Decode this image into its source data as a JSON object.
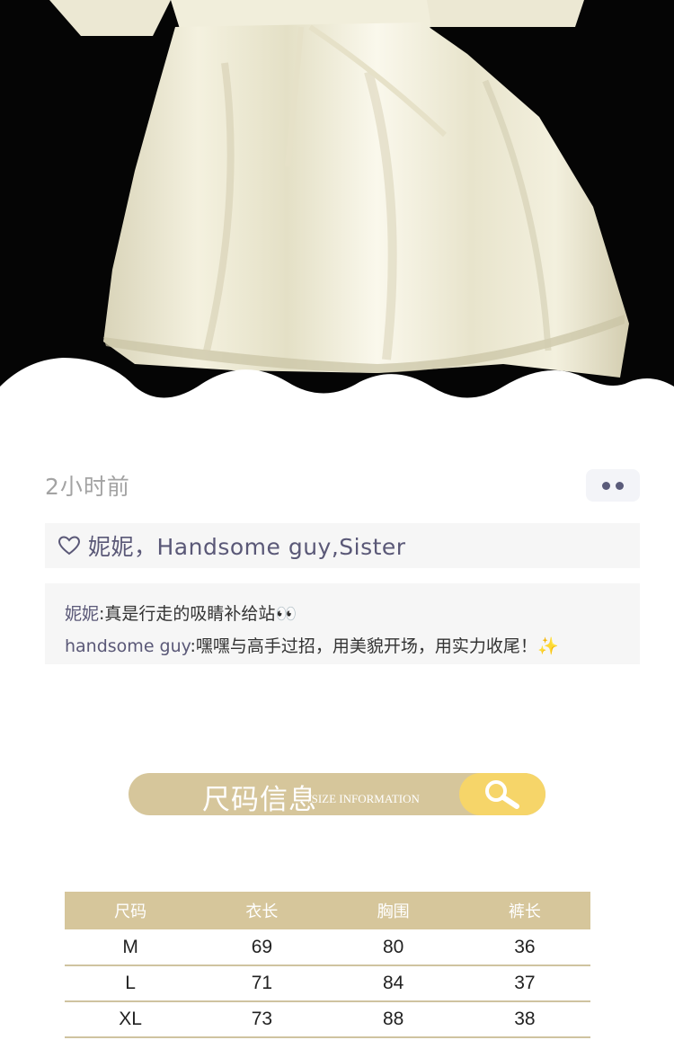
{
  "post": {
    "time": "2小时前",
    "likes": "妮妮，Handsome guy,Sister",
    "comments": [
      {
        "author": "妮妮",
        "text": "真是行走的吸睛补给站",
        "emoji": "👀"
      },
      {
        "author": "handsome guy",
        "text": "嘿嘿与高手过招，用美貌开场，用实力收尾！",
        "emoji": "✨"
      }
    ]
  },
  "section": {
    "title_cn": "尺码信息",
    "title_en": "/SIZE INFORMATION"
  },
  "size_table": {
    "headers": [
      "尺码",
      "衣长",
      "胸围",
      "裤长"
    ],
    "rows": [
      [
        "M",
        "69",
        "80",
        "36"
      ],
      [
        "L",
        "71",
        "84",
        "37"
      ],
      [
        "XL",
        "73",
        "88",
        "38"
      ]
    ]
  },
  "colors": {
    "accent_tan": "#d6c69b",
    "search_yellow": "#f6d569",
    "name_purple": "#5a5877"
  }
}
